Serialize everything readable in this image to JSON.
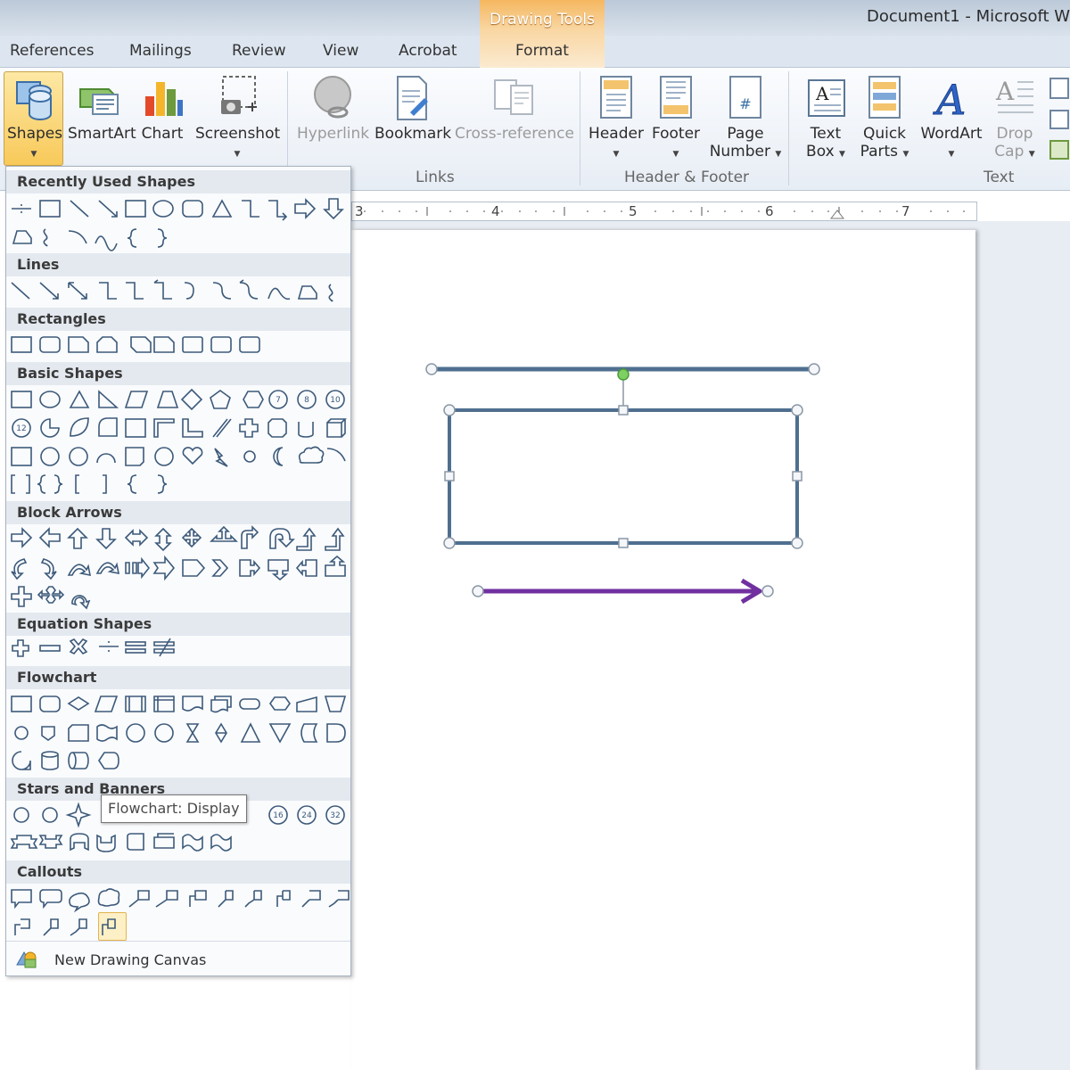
{
  "window": {
    "doc_title": "Document1  -  Microsoft W",
    "contextual_tab_group": "Drawing Tools"
  },
  "tabs": [
    "References",
    "Mailings",
    "Review",
    "View",
    "Acrobat",
    "Format"
  ],
  "ribbon": {
    "illustrations": {
      "shapes": "Shapes",
      "smartart": "SmartArt",
      "chart": "Chart",
      "screenshot": "Screenshot"
    },
    "links": {
      "hyperlink": "Hyperlink",
      "bookmark": "Bookmark",
      "cross_reference": "Cross-reference",
      "group_label": "Links"
    },
    "header_footer": {
      "header": "Header",
      "footer": "Footer",
      "page_number_1": "Page",
      "page_number_2": "Number",
      "group_label": "Header & Footer"
    },
    "text": {
      "text_box_1": "Text",
      "text_box_2": "Box",
      "quick_parts_1": "Quick",
      "quick_parts_2": "Parts",
      "wordart": "WordArt",
      "drop_cap_1": "Drop",
      "drop_cap_2": "Cap",
      "group_label": "Text"
    }
  },
  "ruler": {
    "numbers": [
      "3",
      "4",
      "5",
      "6",
      "7"
    ]
  },
  "gallery": {
    "sections": {
      "recent": "Recently Used Shapes",
      "lines": "Lines",
      "rectangles": "Rectangles",
      "basic": "Basic Shapes",
      "block_arrows": "Block Arrows",
      "equation": "Equation Shapes",
      "flowchart": "Flowchart",
      "stars": "Stars and Banners",
      "callouts": "Callouts"
    },
    "new_canvas_label": "New Drawing Canvas",
    "tooltip": "Flowchart: Display",
    "star_badges": [
      "16",
      "24",
      "32"
    ],
    "basic_badges": [
      "7",
      "8",
      "10",
      "12"
    ]
  },
  "colors": {
    "contextual_orange": "#f5b760",
    "shape_line": "#4f6f8f",
    "arrow_purple": "#7030a0"
  }
}
